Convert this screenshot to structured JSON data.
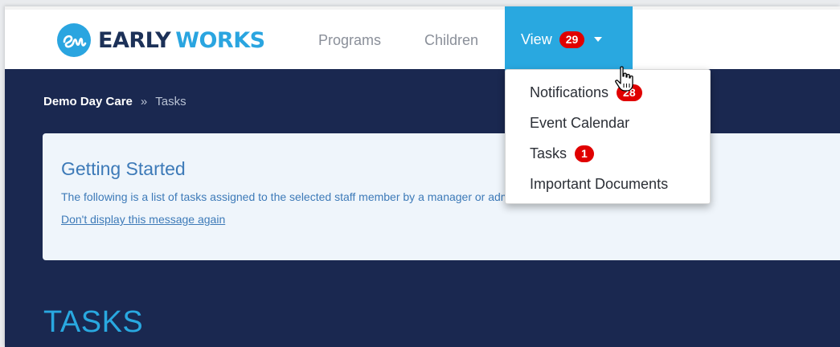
{
  "brand": {
    "early": "EARLY",
    "works": "WORKS",
    "icon": "early-works-logo",
    "colors": {
      "dark": "#1c3158",
      "accent": "#2aa5e0"
    }
  },
  "nav": {
    "programs": "Programs",
    "children": "Children",
    "view": {
      "label": "View",
      "badge": "29",
      "icon": "caret-down-icon"
    }
  },
  "dropdown": {
    "items": [
      {
        "label": "Notifications",
        "badge": "28"
      },
      {
        "label": "Event Calendar"
      },
      {
        "label": "Tasks",
        "badge": "1"
      },
      {
        "label": "Important Documents"
      }
    ]
  },
  "breadcrumb": {
    "home": "Demo Day Care",
    "separator": "»",
    "current": "Tasks"
  },
  "info": {
    "title": "Getting Started",
    "text": "The following is a list of tasks assigned to the selected staff member by a manager or administrator.",
    "dismiss_link": "Don't display this message again"
  },
  "page_heading": "TASKS",
  "colors": {
    "page_background": "#1a2850",
    "nav_active": "#29a8e0",
    "badge": "#e00000",
    "panel_background": "#eff5fb",
    "panel_text": "#3d7ab8"
  }
}
